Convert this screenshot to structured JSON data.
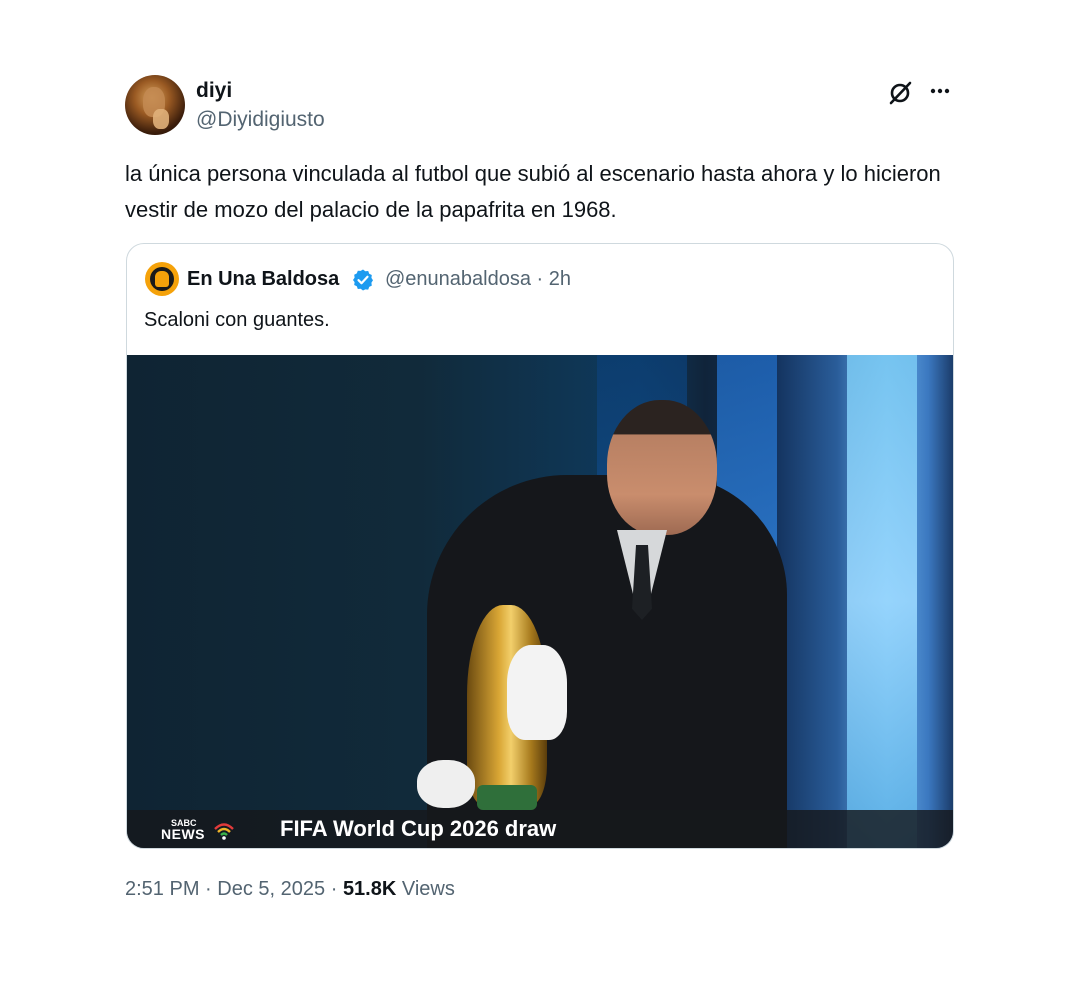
{
  "tweet": {
    "author": {
      "display_name": "diyi",
      "handle": "@Diyidigiusto",
      "avatar_icon": "user-avatar-photo"
    },
    "text": "la única persona vinculada al futbol que subió al escenario hasta ahora y lo hicieron vestir de mozo del palacio de la papafrita en 1968.",
    "actions": {
      "grok_icon": "grok-icon",
      "more_icon": "more-options-icon"
    },
    "quoted": {
      "display_name": "En Una Baldosa",
      "handle": "@enunabaldosa",
      "separator": "·",
      "time": "2h",
      "verified_color": "#1d9bf0",
      "text": "Scaloni con guantes.",
      "media": {
        "broadcaster_top": "SABC",
        "broadcaster_bottom": "NEWS",
        "caption": "FIFA World Cup 2026 draw"
      }
    },
    "meta": {
      "time": "2:51 PM",
      "separator1": "·",
      "date": "Dec 5, 2025",
      "separator2": "·",
      "views_count": "51.8K",
      "views_label": "Views"
    }
  },
  "colors": {
    "text_primary": "#0f1419",
    "text_secondary": "#536471",
    "border": "#cfd9de",
    "accent": "#1d9bf0"
  }
}
